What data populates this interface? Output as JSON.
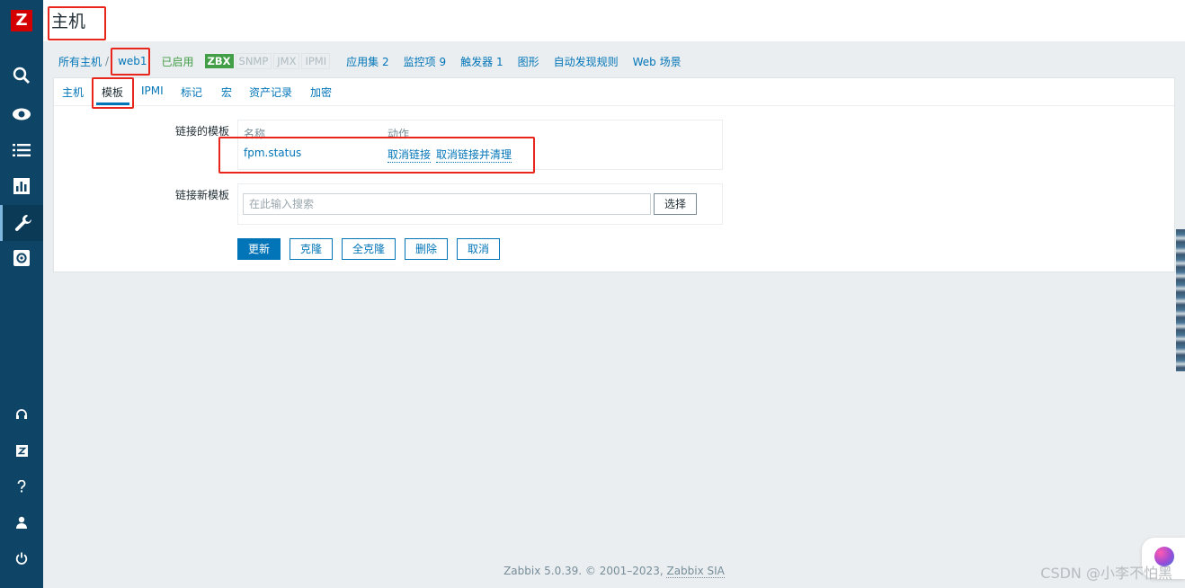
{
  "app": {
    "logo_letter": "Z"
  },
  "sidebar": {
    "icons": [
      "search-icon",
      "eye-icon",
      "list-icon",
      "chart-icon",
      "wrench-icon",
      "gear-icon",
      "headset-icon",
      "zabbix-share-icon",
      "help-icon",
      "user-icon",
      "power-icon"
    ],
    "active": "wrench-icon"
  },
  "header": {
    "title": "主机"
  },
  "breadcrumb": {
    "all_hosts": "所有主机",
    "separator": "/",
    "host": "web1",
    "status": "已启用",
    "badges": {
      "zbx": "ZBX",
      "snmp": "SNMP",
      "jmx": "JMX",
      "ipmi": "IPMI"
    },
    "links": [
      {
        "label": "应用集",
        "count": "2"
      },
      {
        "label": "监控项",
        "count": "9"
      },
      {
        "label": "触发器",
        "count": "1"
      },
      {
        "label": "图形",
        "count": ""
      },
      {
        "label": "自动发现规则",
        "count": ""
      },
      {
        "label": "Web 场景",
        "count": ""
      }
    ]
  },
  "tabs": [
    "主机",
    "模板",
    "IPMI",
    "标记",
    "宏",
    "资产记录",
    "加密"
  ],
  "active_tab": "模板",
  "form": {
    "linked_label": "链接的模板",
    "table": {
      "col_name": "名称",
      "col_action": "动作",
      "rows": [
        {
          "name": "fpm.status",
          "unlink": "取消链接",
          "unlink_clear": "取消链接并清理"
        }
      ]
    },
    "new_label": "链接新模板",
    "search_placeholder": "在此输入搜索",
    "select_label": "选择",
    "buttons": {
      "update": "更新",
      "clone": "克隆",
      "full_clone": "全克隆",
      "delete": "删除",
      "cancel": "取消"
    }
  },
  "footer": {
    "text": "Zabbix 5.0.39. © 2001–2023,",
    "link": "Zabbix SIA"
  },
  "watermark": "CSDN @小李不怕黑",
  "colors": {
    "sidebar": "#0e4466",
    "link": "#0275b8",
    "enabled": "#429e47",
    "highlight": "#e8261c"
  }
}
